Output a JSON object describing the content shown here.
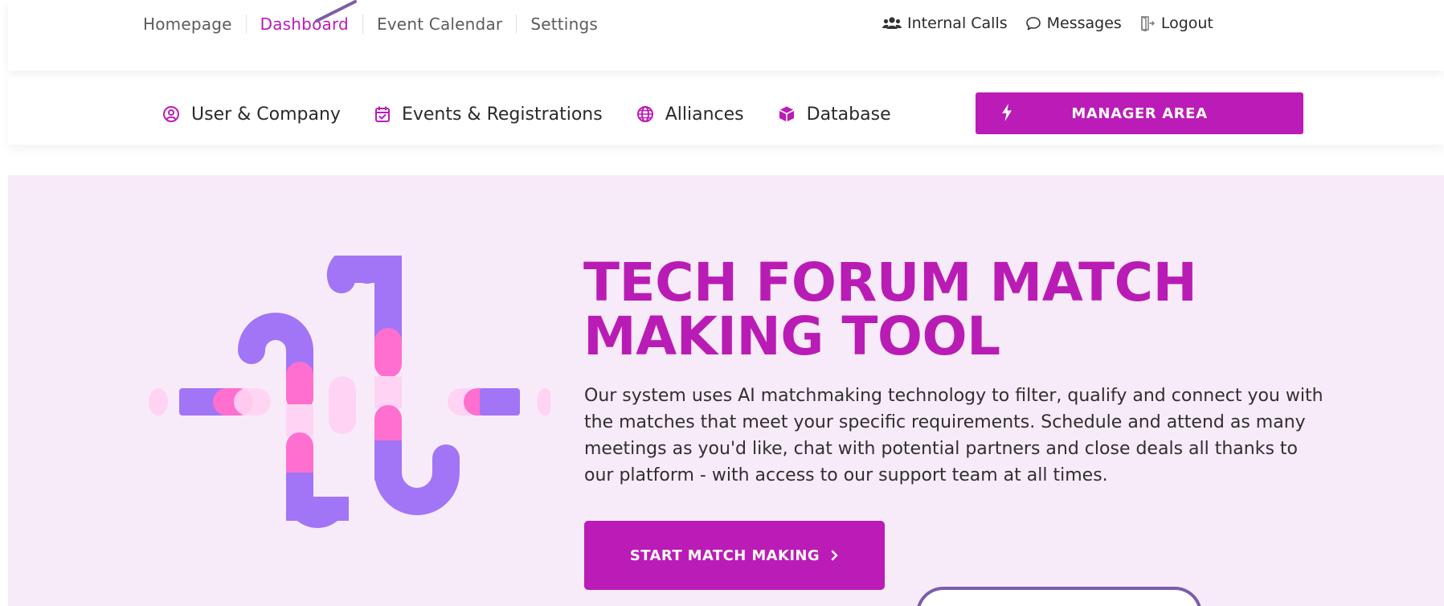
{
  "top_nav": {
    "items": [
      {
        "label": "Homepage",
        "active": false
      },
      {
        "label": "Dashboard",
        "active": true
      },
      {
        "label": "Event Calendar",
        "active": false
      },
      {
        "label": "Settings",
        "active": false
      }
    ],
    "utility": {
      "internal_calls": {
        "label": "Internal Calls",
        "icon": "users-icon"
      },
      "messages": {
        "label": "Messages",
        "icon": "chat-bubble-icon"
      },
      "logout": {
        "label": "Logout",
        "icon": "logout-icon"
      }
    }
  },
  "sub_nav": {
    "items": [
      {
        "label": "User & Company",
        "icon": "user-circle-icon"
      },
      {
        "label": "Events & Registrations",
        "icon": "calendar-check-icon"
      },
      {
        "label": "Alliances",
        "icon": "globe-icon"
      },
      {
        "label": "Database",
        "icon": "cube-icon"
      }
    ],
    "manager_button": {
      "label": "MANAGER AREA",
      "icon": "bolt-icon"
    }
  },
  "hero": {
    "title_line1": "TECH FORUM MATCH",
    "title_line2": "MAKING TOOL",
    "description": "Our system uses AI matchmaking technology to filter, qualify and connect you with the matches that meet your specific requirements. Schedule and attend as many meetings as you'd like, chat with potential partners and close deals all thanks to our platform - with access to our support team at all times.",
    "cta": {
      "label": "START MATCH MAKING",
      "icon": "chevron-right-icon"
    }
  },
  "colors": {
    "brand": "#bb1bb6",
    "hero_background": "#f8ebf9",
    "illustration_purple": "#a175f5",
    "illustration_pink": "#ff6fcf",
    "illustration_light_pink": "#ffd3f3",
    "overlay_border": "#7c5da8"
  }
}
